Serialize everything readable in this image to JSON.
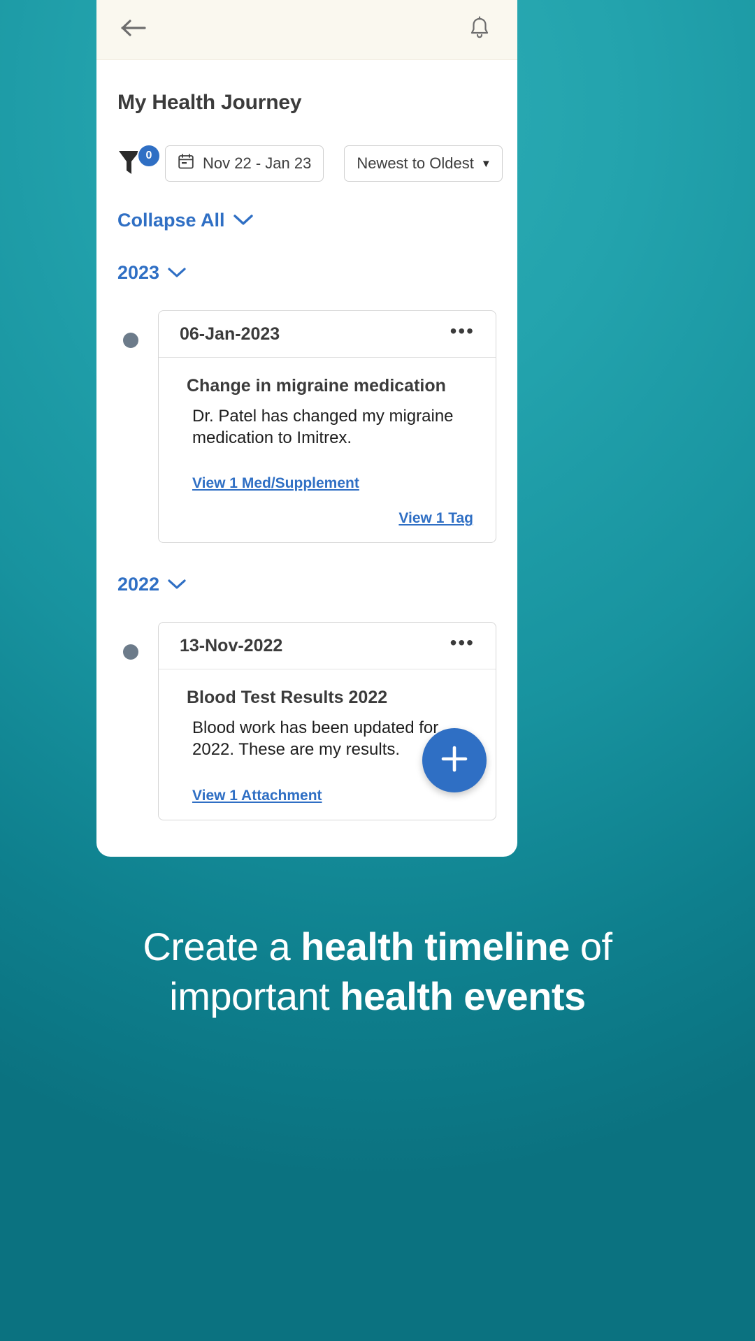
{
  "appbar": {
    "back_icon": "arrow-left-icon",
    "bell_icon": "notification-bell-icon"
  },
  "page_title": "My Health Journey",
  "filters": {
    "funnel_icon": "filter-funnel-icon",
    "filter_count": "0",
    "date_range": "Nov 22 - Jan 23",
    "calendar_icon": "calendar-icon",
    "sort_label": "Newest to Oldest",
    "sort_caret": "▼"
  },
  "collapse_all": {
    "label": "Collapse All",
    "caret": "chevron-down-icon"
  },
  "groups": [
    {
      "year": "2023",
      "events": [
        {
          "date": "06-Jan-2023",
          "menu": "•••",
          "title": "Change in migraine medication",
          "description": "Dr. Patel has changed my migraine medication to Imitrex.",
          "link_left": "View 1 Med/Supplement",
          "link_right": "View 1 Tag"
        }
      ]
    },
    {
      "year": "2022",
      "events": [
        {
          "date": "13-Nov-2022",
          "menu": "•••",
          "title": "Blood Test Results 2022",
          "description": "Blood work has been updated for 2022. These are my results.",
          "link_left": "View 1 Attachment",
          "link_right": ""
        }
      ]
    }
  ],
  "fab": {
    "icon": "plus-icon",
    "label": "+"
  },
  "caption": {
    "line1_a": "Create a ",
    "line1_b": "health timeline",
    "line1_c": " of",
    "line2_a": "important ",
    "line2_b": "health events"
  },
  "colors": {
    "accent_blue": "#2f6fc4",
    "background_teal": "#18939f",
    "appbar_cream": "#faf8ef",
    "dot_gray": "#6c7b8a"
  }
}
